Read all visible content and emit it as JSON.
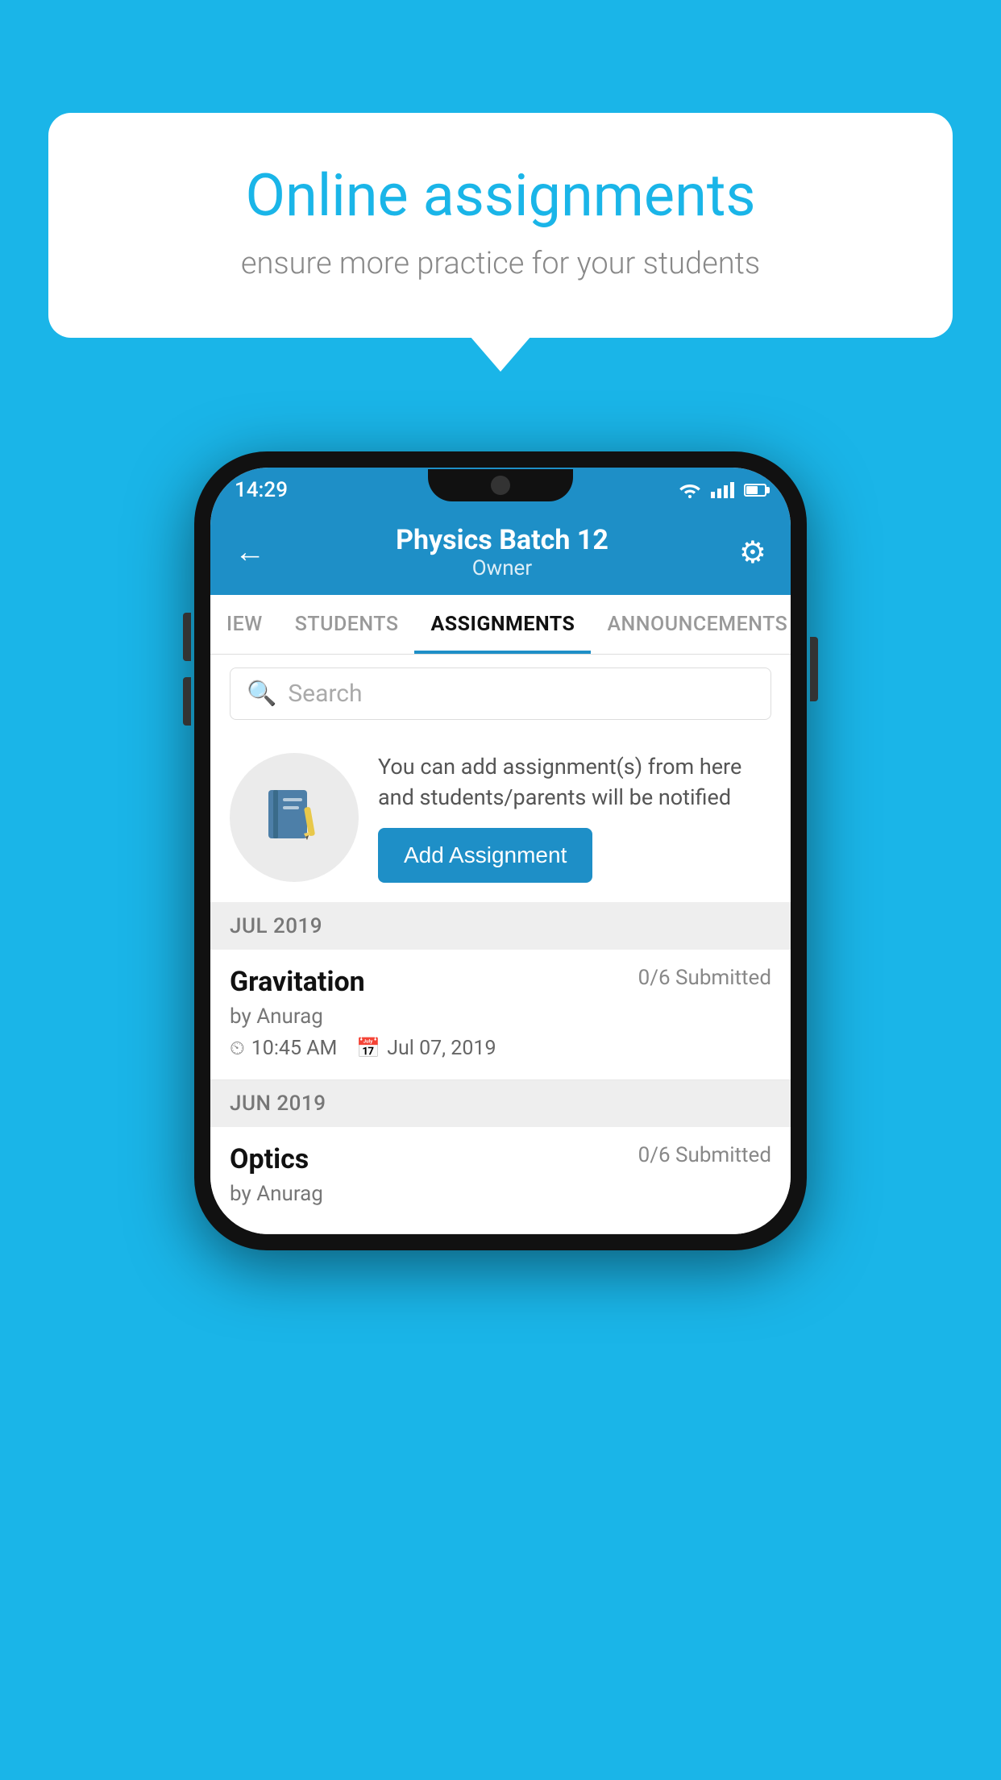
{
  "background_color": "#1ab5e8",
  "speech_bubble": {
    "title": "Online assignments",
    "subtitle": "ensure more practice for your students"
  },
  "phone": {
    "status_bar": {
      "time": "14:29"
    },
    "header": {
      "title": "Physics Batch 12",
      "subtitle": "Owner",
      "back_label": "←",
      "gear_label": "⚙"
    },
    "tabs": [
      {
        "label": "IEW",
        "active": false
      },
      {
        "label": "STUDENTS",
        "active": false
      },
      {
        "label": "ASSIGNMENTS",
        "active": true
      },
      {
        "label": "ANNOUNCEMENTS",
        "active": false
      }
    ],
    "search": {
      "placeholder": "Search"
    },
    "promo": {
      "description": "You can add assignment(s) from here and students/parents will be notified",
      "add_button_label": "Add Assignment"
    },
    "sections": [
      {
        "month": "JUL 2019",
        "assignments": [
          {
            "title": "Gravitation",
            "status": "0/6 Submitted",
            "author": "by Anurag",
            "time": "10:45 AM",
            "date": "Jul 07, 2019"
          }
        ]
      },
      {
        "month": "JUN 2019",
        "assignments": [
          {
            "title": "Optics",
            "status": "0/6 Submitted",
            "author": "by Anurag",
            "time": "",
            "date": ""
          }
        ]
      }
    ]
  }
}
